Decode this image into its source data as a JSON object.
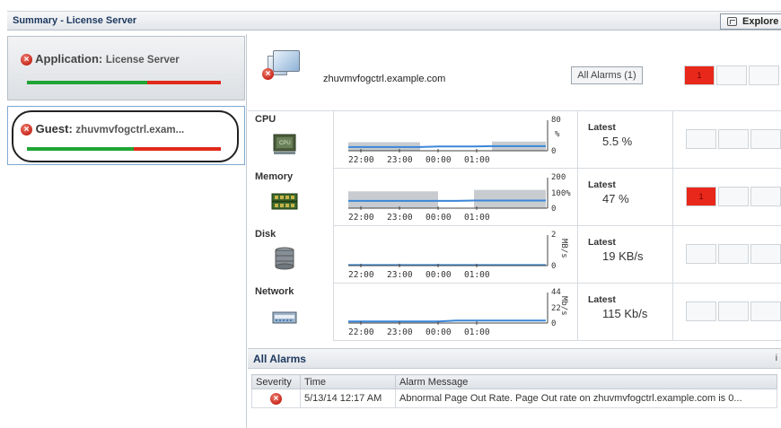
{
  "header": {
    "title": "Summary - License Server",
    "explore_label": "Explore"
  },
  "left": {
    "application": {
      "prefix": "Application:",
      "name": "License Server",
      "health_ok_fraction": 0.62
    },
    "guest": {
      "prefix": "Guest:",
      "name": "zhuvmvfogctrl.exam...",
      "health_ok_fraction": 0.55
    }
  },
  "host": {
    "name": "zhuvmvfogctrl.example.com",
    "all_alarms_label": "All Alarms (1)",
    "alarm_count_cell": "1"
  },
  "metrics": [
    {
      "label": "CPU",
      "latest_label": "Latest",
      "latest_value": "5.5 %",
      "axis_top": "80",
      "axis_unit": "%",
      "axis_mid": "",
      "axis_bottom": "0",
      "alarm_badge": ""
    },
    {
      "label": "Memory",
      "latest_label": "Latest",
      "latest_value": "47 %",
      "axis_top": "200",
      "axis_unit": "%",
      "axis_mid": "100",
      "axis_bottom": "0",
      "alarm_badge": "1"
    },
    {
      "label": "Disk",
      "latest_label": "Latest",
      "latest_value": "19 KB/s",
      "axis_top": "2",
      "axis_unit": "MB/s",
      "axis_mid": "",
      "axis_bottom": "0",
      "alarm_badge": ""
    },
    {
      "label": "Network",
      "latest_label": "Latest",
      "latest_value": "115 Kb/s",
      "axis_top": "44",
      "axis_unit": "Mb/s",
      "axis_mid": "22",
      "axis_bottom": "0",
      "alarm_badge": ""
    }
  ],
  "time_ticks": [
    "22:00",
    "23:00",
    "00:00",
    "01:00"
  ],
  "alarms": {
    "title": "All Alarms",
    "info_label": "i",
    "columns": [
      "Severity",
      "Time",
      "Alarm Message"
    ],
    "rows": [
      {
        "severity_icon": "error-icon",
        "time": "5/13/14 12:17 AM",
        "message": "Abnormal Page Out Rate. Page Out rate on zhuvmvfogctrl.example.com is 0..."
      }
    ]
  },
  "colors": {
    "error": "#d0301f",
    "healthy": "#1fa534",
    "unhealthy": "#e02a1a",
    "alarm_red": "#e8281a",
    "header_text": "#1e3a60"
  }
}
